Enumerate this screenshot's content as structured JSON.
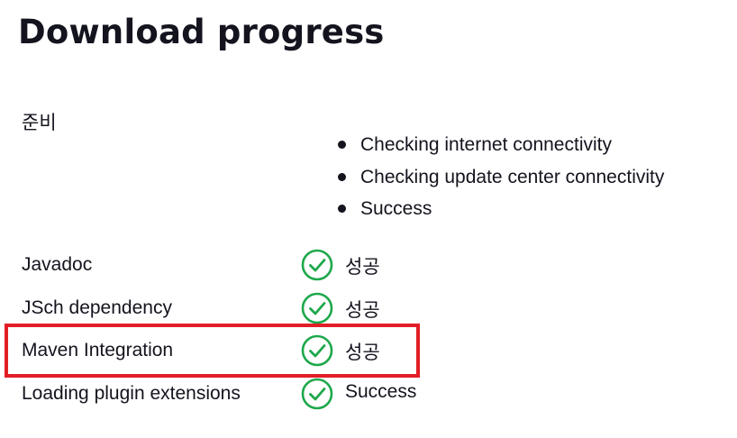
{
  "page": {
    "title": "Download progress"
  },
  "preparation": {
    "label": "준비",
    "steps": [
      "Checking internet connectivity",
      "Checking update center connectivity",
      "Success"
    ]
  },
  "plugins": [
    {
      "name": "Javadoc",
      "status": "성공",
      "status_icon": "check-circle-icon"
    },
    {
      "name": "JSch dependency",
      "status": "성공",
      "status_icon": "check-circle-icon"
    },
    {
      "name": "Maven Integration",
      "status": "성공",
      "status_icon": "check-circle-icon"
    },
    {
      "name": "Loading plugin extensions",
      "status": "Success",
      "status_icon": "check-circle-icon"
    }
  ],
  "colors": {
    "success": "#1ea84b",
    "highlight": "#e21e26",
    "text": "#14141f"
  }
}
